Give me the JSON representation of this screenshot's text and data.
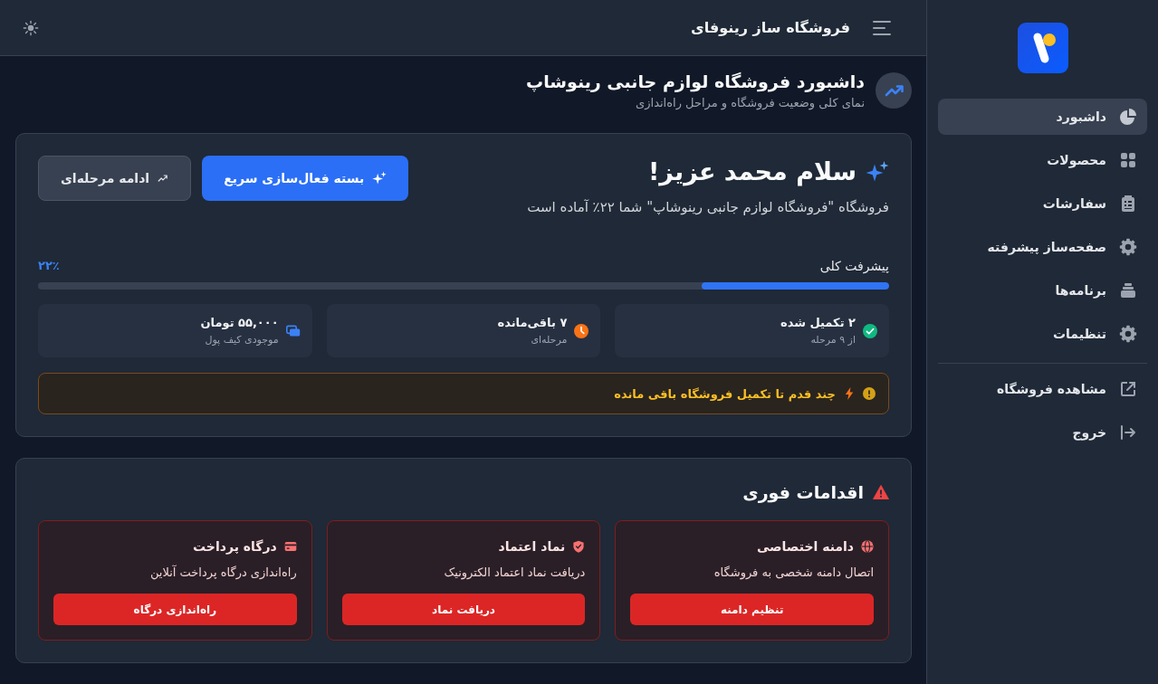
{
  "sidebar": {
    "items": [
      {
        "label": "داشبورد",
        "selected": true
      },
      {
        "label": "محصولات",
        "selected": false
      },
      {
        "label": "سفارشات",
        "selected": false
      },
      {
        "label": "صفحه‌ساز پیشرفته",
        "selected": false
      },
      {
        "label": "برنامه‌ها",
        "selected": false
      },
      {
        "label": "تنظیمات",
        "selected": false
      }
    ],
    "links": [
      {
        "label": "مشاهده فروشگاه"
      },
      {
        "label": "خروج"
      }
    ]
  },
  "topbar": {
    "title": "فروشگاه ساز رینوفای"
  },
  "page_header": {
    "title": "داشبورد فروشگاه لوازم جانبی رینوشاپ",
    "subtitle": "نمای کلی وضعیت فروشگاه و مراحل راه‌اندازی"
  },
  "welcome": {
    "greeting": "سلام محمد عزیز!",
    "message": "فروشگاه \"فروشگاه لوازم جانبی رینوشاپ\" شما ۲۲٪ آماده است",
    "buttons": [
      {
        "label": "بسته فعال‌سازی سریع",
        "kind": "primary"
      },
      {
        "label": "ادامه مرحله‌ای",
        "kind": "secondary"
      }
    ],
    "progress": {
      "label": "پیشرفت کلی",
      "value": "۲۲٪",
      "level": 0.22
    },
    "stats": [
      {
        "value": "۲ تکمیل شده",
        "caption": "از ۹ مرحله",
        "color": "#10b981"
      },
      {
        "value": "۷ باقی‌مانده",
        "caption": "مرحله‌ای",
        "color": "#f97316"
      },
      {
        "value": "۵۵,۰۰۰ تومان",
        "caption": "موجودی کیف پول",
        "color": "#3b82f6"
      }
    ],
    "notice": {
      "text": "چند قدم تا تکمیل فروشگاه باقی مانده"
    }
  },
  "urgent": {
    "title": "اقدامات فوری",
    "actions": [
      {
        "title": "دامنه اختصاصی",
        "description": "اتصال دامنه شخصی به فروشگاه",
        "button": "تنظیم دامنه"
      },
      {
        "title": "نماد اعتماد",
        "description": "دریافت نماد اعتماد الکترونیک",
        "button": "دریافت نماد"
      },
      {
        "title": "درگاه پرداخت",
        "description": "راه‌اندازی درگاه پرداخت آنلاین",
        "button": "راه‌اندازی درگاه"
      }
    ]
  }
}
